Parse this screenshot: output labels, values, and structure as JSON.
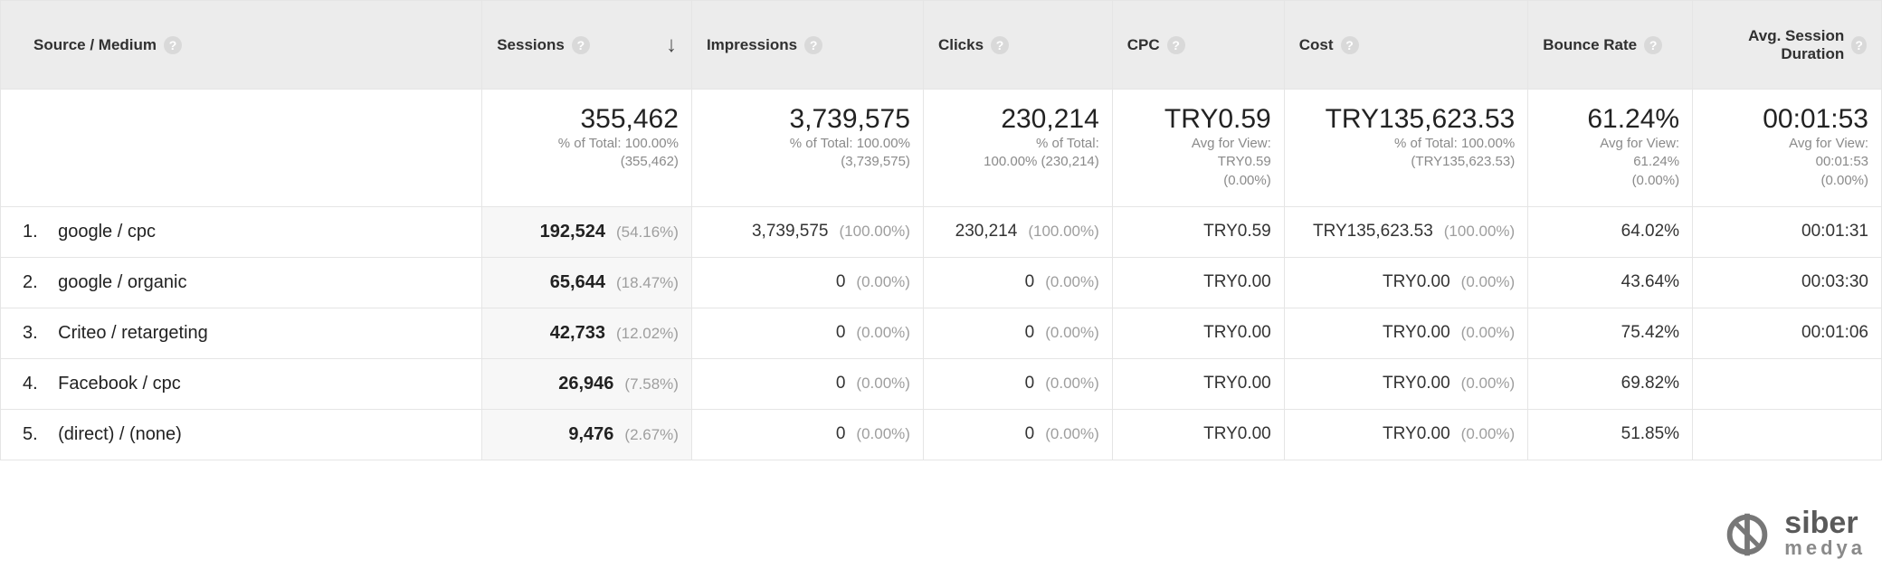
{
  "columns": {
    "source_medium": "Source / Medium",
    "sessions": "Sessions",
    "impressions": "Impressions",
    "clicks": "Clicks",
    "cpc": "CPC",
    "cost": "Cost",
    "bounce_rate": "Bounce Rate",
    "avg_session_duration": "Avg. Session Duration"
  },
  "help_glyph": "?",
  "sort_arrow": "↓",
  "totals": {
    "sessions": {
      "value": "355,462",
      "sub1": "% of Total: 100.00%",
      "sub2": "(355,462)"
    },
    "impressions": {
      "value": "3,739,575",
      "sub1": "% of Total: 100.00%",
      "sub2": "(3,739,575)"
    },
    "clicks": {
      "value": "230,214",
      "sub1": "% of Total:",
      "sub2": "100.00% (230,214)"
    },
    "cpc": {
      "value": "TRY0.59",
      "sub1": "Avg for View:",
      "sub2": "TRY0.59",
      "sub3": "(0.00%)"
    },
    "cost": {
      "value": "TRY135,623.53",
      "sub1": "% of Total: 100.00%",
      "sub2": "(TRY135,623.53)"
    },
    "bounce_rate": {
      "value": "61.24%",
      "sub1": "Avg for View:",
      "sub2": "61.24%",
      "sub3": "(0.00%)"
    },
    "avg_duration": {
      "value": "00:01:53",
      "sub1": "Avg for View:",
      "sub2": "00:01:53",
      "sub3": "(0.00%)"
    }
  },
  "rows": [
    {
      "idx": "1.",
      "name": "google / cpc",
      "sessions": "192,524",
      "sessions_pct": "(54.16%)",
      "impressions": "3,739,575",
      "impressions_pct": "(100.00%)",
      "clicks": "230,214",
      "clicks_pct": "(100.00%)",
      "cpc": "TRY0.59",
      "cost": "TRY135,623.53",
      "cost_pct": "(100.00%)",
      "bounce": "64.02%",
      "duration": "00:01:31"
    },
    {
      "idx": "2.",
      "name": "google / organic",
      "sessions": "65,644",
      "sessions_pct": "(18.47%)",
      "impressions": "0",
      "impressions_pct": "(0.00%)",
      "clicks": "0",
      "clicks_pct": "(0.00%)",
      "cpc": "TRY0.00",
      "cost": "TRY0.00",
      "cost_pct": "(0.00%)",
      "bounce": "43.64%",
      "duration": "00:03:30"
    },
    {
      "idx": "3.",
      "name": "Criteo / retargeting",
      "sessions": "42,733",
      "sessions_pct": "(12.02%)",
      "impressions": "0",
      "impressions_pct": "(0.00%)",
      "clicks": "0",
      "clicks_pct": "(0.00%)",
      "cpc": "TRY0.00",
      "cost": "TRY0.00",
      "cost_pct": "(0.00%)",
      "bounce": "75.42%",
      "duration": "00:01:06"
    },
    {
      "idx": "4.",
      "name": "Facebook / cpc",
      "sessions": "26,946",
      "sessions_pct": "(7.58%)",
      "impressions": "0",
      "impressions_pct": "(0.00%)",
      "clicks": "0",
      "clicks_pct": "(0.00%)",
      "cpc": "TRY0.00",
      "cost": "TRY0.00",
      "cost_pct": "(0.00%)",
      "bounce": "69.82%",
      "duration": ""
    },
    {
      "idx": "5.",
      "name": "(direct) / (none)",
      "sessions": "9,476",
      "sessions_pct": "(2.67%)",
      "impressions": "0",
      "impressions_pct": "(0.00%)",
      "clicks": "0",
      "clicks_pct": "(0.00%)",
      "cpc": "TRY0.00",
      "cost": "TRY0.00",
      "cost_pct": "(0.00%)",
      "bounce": "51.85%",
      "duration": ""
    }
  ],
  "watermark": {
    "line1": "siber",
    "line2": "medya"
  }
}
